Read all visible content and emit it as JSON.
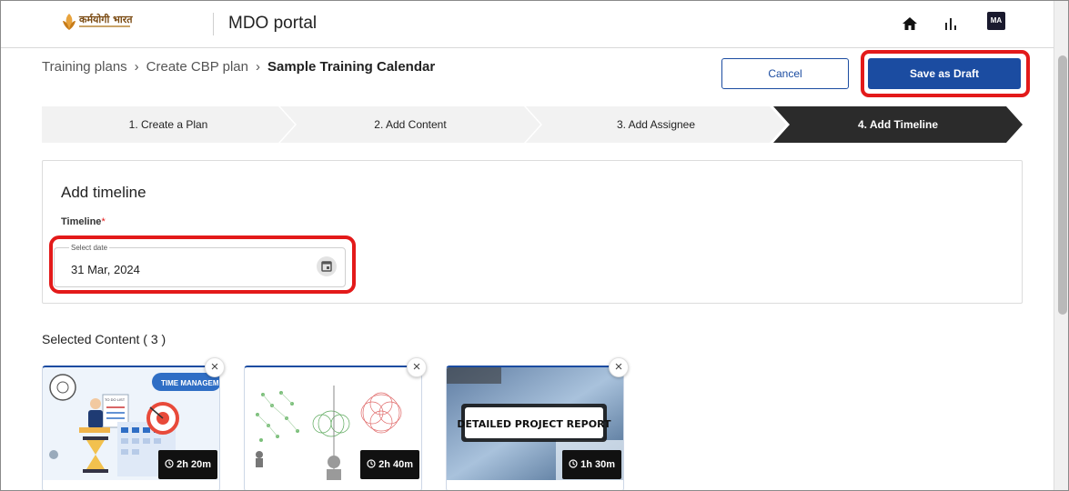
{
  "header": {
    "logo_text": "कर्मयोगी भारत",
    "portal_title": "MDO portal",
    "avatar_initials": "MA",
    "icons": [
      "home-icon",
      "analytics-icon"
    ]
  },
  "breadcrumb": {
    "items": [
      "Training plans",
      "Create CBP plan"
    ],
    "separator": "›",
    "current": "Sample Training Calendar"
  },
  "actions": {
    "cancel_label": "Cancel",
    "save_label": "Save as Draft"
  },
  "stepper": {
    "steps": [
      {
        "label": "1. Create a Plan",
        "active": false
      },
      {
        "label": "2. Add Content",
        "active": false
      },
      {
        "label": "3. Add Assignee",
        "active": false
      },
      {
        "label": "4. Add Timeline",
        "active": true
      }
    ]
  },
  "timeline": {
    "title": "Add timeline",
    "field_label": "Timeline",
    "required_mark": "*",
    "date_caption": "Select date",
    "date_value": "31 Mar, 2024"
  },
  "selected_content": {
    "title": "Selected Content ( 3 )",
    "items": [
      {
        "duration": "2h 20m",
        "thumb_text": "TIME MANAGEM",
        "thumb_subtext": "TO DO LIST"
      },
      {
        "duration": "2h 40m"
      },
      {
        "duration": "1h 30m",
        "thumb_text": "DETAILED PROJECT REPORT"
      }
    ]
  },
  "colors": {
    "primary": "#1b4ca1",
    "highlight": "#e31a1a",
    "active_step": "#2b2b2b",
    "inactive_step": "#f2f2f2"
  }
}
